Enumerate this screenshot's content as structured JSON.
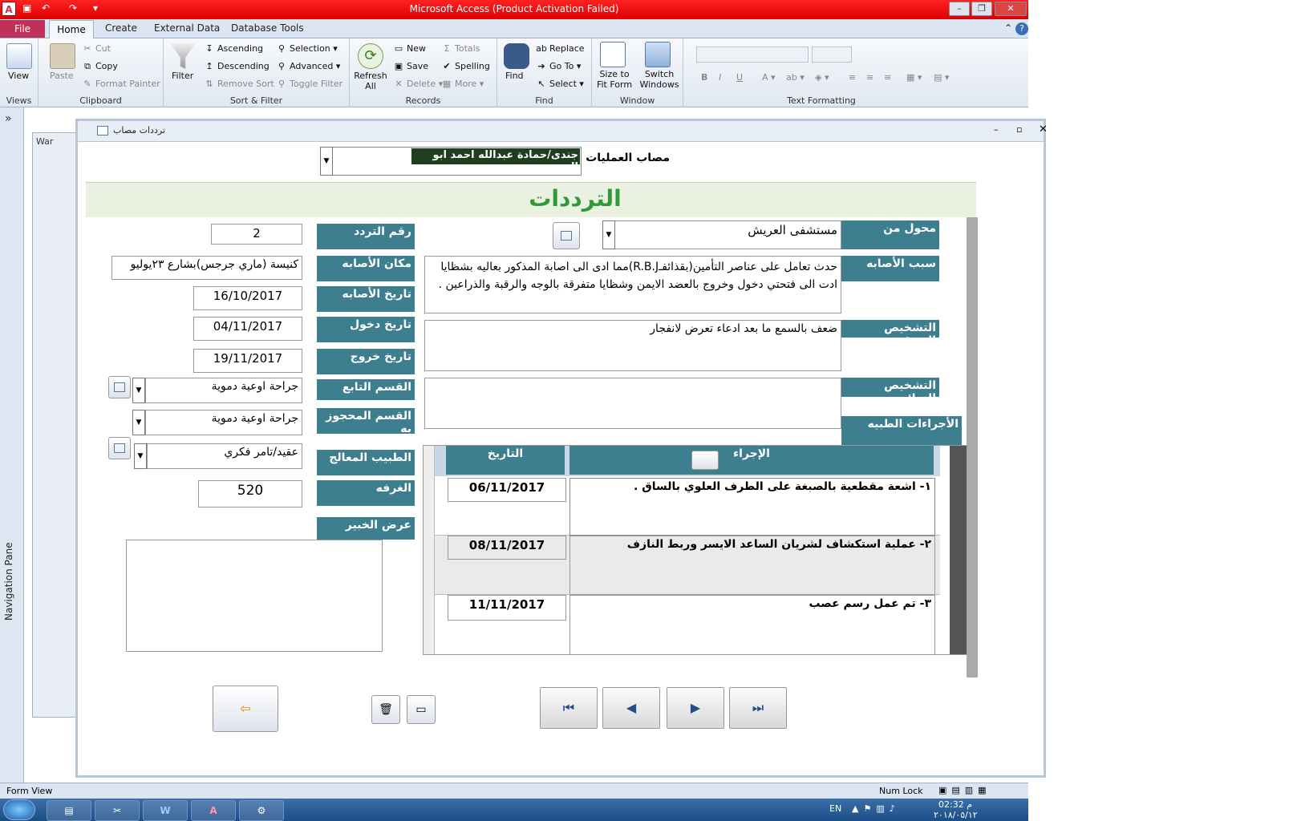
{
  "window": {
    "title": "Microsoft Access (Product Activation Failed)"
  },
  "ribbon_tabs": {
    "file": "File",
    "home": "Home",
    "create": "Create",
    "external": "External Data",
    "dbtools": "Database Tools"
  },
  "ribbon": {
    "view": "View",
    "views_group": "Views",
    "paste": "Paste",
    "cut": "Cut",
    "copy": "Copy",
    "format_painter": "Format Painter",
    "clipboard_group": "Clipboard",
    "filter": "Filter",
    "ascending": "Ascending",
    "descending": "Descending",
    "remove_sort": "Remove Sort",
    "selection": "Selection",
    "advanced": "Advanced",
    "toggle_filter": "Toggle Filter",
    "sortfilter_group": "Sort & Filter",
    "refresh": "Refresh All",
    "new": "New",
    "save": "Save",
    "delete": "Delete",
    "totals": "Totals",
    "spelling": "Spelling",
    "more": "More",
    "records_group": "Records",
    "find": "Find",
    "replace": "Replace",
    "goto": "Go To",
    "select": "Select",
    "find_group": "Find",
    "size_fit": "Size to Fit Form",
    "switch_windows": "Switch Windows",
    "window_group": "Window",
    "textfmt_group": "Text Formatting"
  },
  "nav_pane": {
    "label": "Navigation Pane"
  },
  "form": {
    "window_title": "ترددات مصاب",
    "header_label": "مصاب العمليات",
    "header_value": "جندى/حمادة عبدالله احمد ابو العنين",
    "section_title": "الترددات",
    "labels": {
      "visit_no": "رقم التردد",
      "injury_place": "مكان الأصابه",
      "injury_date": "تاريخ الأصابه",
      "entry_date": "تاريخ دخول",
      "exit_date": "تاريخ خروج",
      "dept": "القسم التابع",
      "reserved_dept": "القسم المحجوز به",
      "doctor": "الطبيب المعالج",
      "room": "الغرفه",
      "expert_view": "عرض الخبير",
      "referred_from": "محول من",
      "injury_cause": "سبب الأصابه",
      "initial_dx": "التشخيص المبدئى",
      "final_dx": "التشخيص النهائى",
      "procedures": "الأجراءات الطبيه"
    },
    "values": {
      "visit_no": "2",
      "injury_place": "كنيسة (ماري جرجس)بشارع ٢٣يوليو",
      "injury_date": "16/10/2017",
      "entry_date": "04/11/2017",
      "exit_date": "19/11/2017",
      "dept": "جراحة اوعية دموية",
      "reserved_dept": "جراحة اوعية دموية",
      "doctor": "عقيد/تامر فكري",
      "room": "520",
      "referred_from": "مستشفى العريش",
      "injury_cause": "حدث تعامل على عناصر التأمين(بقذائفـR.B.J)مما ادى الى اصابة المذكور بعاليه بشظايا ادت الى فتحتي دخول وخروج بالعضد الايمن وشظايا متفرقة بالوجه والرقبة والذراعين .",
      "initial_dx": "ضعف بالسمع ما بعد ادعاء تعرض لانفجار",
      "final_dx": ""
    },
    "subform": {
      "col_date": "التاريخ",
      "col_procedure": "الإجراء",
      "rows": [
        {
          "date": "06/11/2017",
          "procedure": "١- اشعة مقطعية بالصبغة على الطرف العلوي بالساق ."
        },
        {
          "date": "08/11/2017",
          "procedure": "٢- عملية استكشاف لشريان الساعد الايسر وربط النازف"
        },
        {
          "date": "11/11/2017",
          "procedure": "٣- تم عمل رسم عصب"
        }
      ]
    }
  },
  "behind_form": {
    "tab": "War"
  },
  "status": {
    "left": "Form View",
    "right": "Num Lock"
  },
  "taskbar": {
    "lang": "EN",
    "time": "02:32 م",
    "date": "٢٠١٨/٠٥/١٢"
  }
}
